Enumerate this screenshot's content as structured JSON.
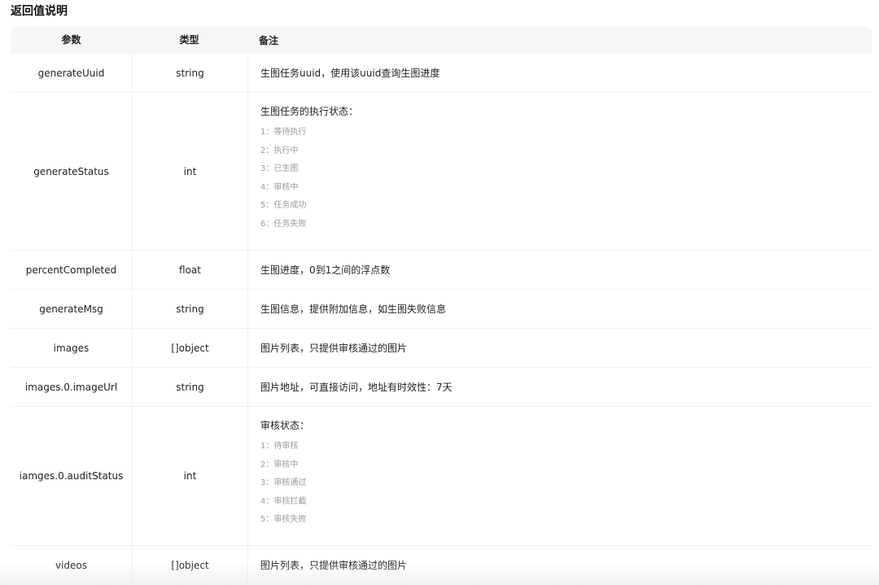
{
  "section_title": "返回值说明",
  "table": {
    "headers": {
      "param": "参数",
      "type": "类型",
      "note": "备注"
    },
    "rows": [
      {
        "param": "generateUuid",
        "type": "string",
        "note": "生图任务uuid，使用该uuid查询生图进度"
      },
      {
        "param": "generateStatus",
        "type": "int",
        "note": "生图任务的执行状态：",
        "items": [
          "1：等待执行",
          "2：执行中",
          "3：已生图",
          "4：审核中",
          "5：任务成功",
          "6：任务失败"
        ]
      },
      {
        "param": "percentCompleted",
        "type": "float",
        "note": "生图进度，0到1之间的浮点数"
      },
      {
        "param": "generateMsg",
        "type": "string",
        "note": "生图信息，提供附加信息，如生图失败信息"
      },
      {
        "param": "images",
        "type": "[]object",
        "note": "图片列表，只提供审核通过的图片"
      },
      {
        "param": "images.0.imageUrl",
        "type": "string",
        "note": "图片地址，可直接访问，地址有时效性：7天"
      },
      {
        "param": "iamges.0.auditStatus",
        "type": "int",
        "note": "审核状态：",
        "items": [
          "1：待审核",
          "2：审核中",
          "3：审核通过",
          "4：审核拦截",
          "5：审核失败"
        ]
      },
      {
        "param": "videos",
        "type": "[]object",
        "note": "图片列表，只提供审核通过的图片"
      }
    ]
  }
}
